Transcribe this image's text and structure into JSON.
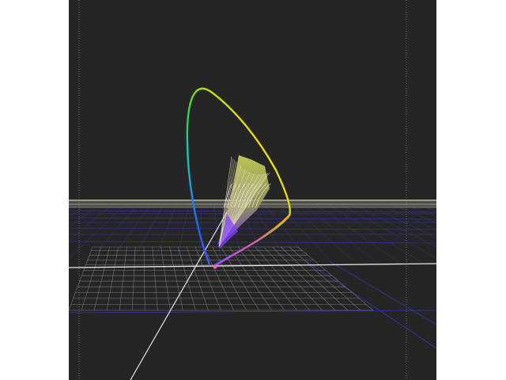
{
  "viewer": {
    "background_color": "#252525",
    "page_color": "#ffffff",
    "frame_color": "#8a8a8a",
    "horizon_band_color": "#9a9a88",
    "far_grid_color": "#3a3ad0",
    "near_grid_color": "#9a9a9a",
    "axis_color": "#e6e6e6"
  },
  "figure": {
    "kind": "cie-chromaticity-gamut-3d",
    "locus_gradient": [
      "#a040ff",
      "#2060ff",
      "#20c0c0",
      "#40d040",
      "#c0e000",
      "#ffe000",
      "#ff8000",
      "#ff2060"
    ],
    "white_point_color": "#ff60c0",
    "gamut_top_color": "#d8e060",
    "gamut_mid_color": "#a0a060",
    "gamut_bottom_color": "#8040ff"
  }
}
